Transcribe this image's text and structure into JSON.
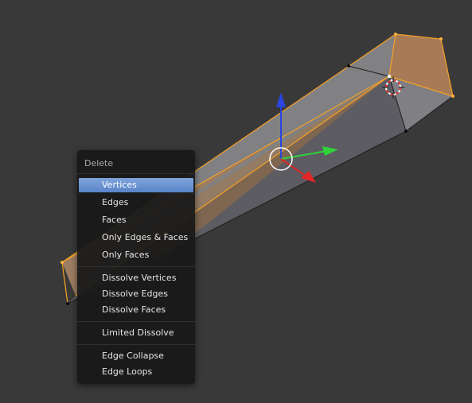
{
  "colors": {
    "background": "#393939",
    "selection_orange": "#f7a126",
    "menu_highlight": "#5680c2",
    "axis_z": "#2a45e0",
    "axis_y": "#2fd23a",
    "axis_x": "#e02626"
  },
  "menu": {
    "title": "Delete",
    "items": [
      {
        "label": "Vertices",
        "active": true
      },
      {
        "label": "Edges"
      },
      {
        "label": "Faces"
      },
      {
        "label": "Only Edges & Faces"
      },
      {
        "label": "Only Faces"
      },
      {
        "label": "Dissolve Vertices"
      },
      {
        "label": "Dissolve Edges"
      },
      {
        "label": "Dissolve Faces"
      },
      {
        "label": "Limited Dissolve"
      },
      {
        "label": "Edge Collapse"
      },
      {
        "label": "Edge Loops"
      }
    ]
  }
}
